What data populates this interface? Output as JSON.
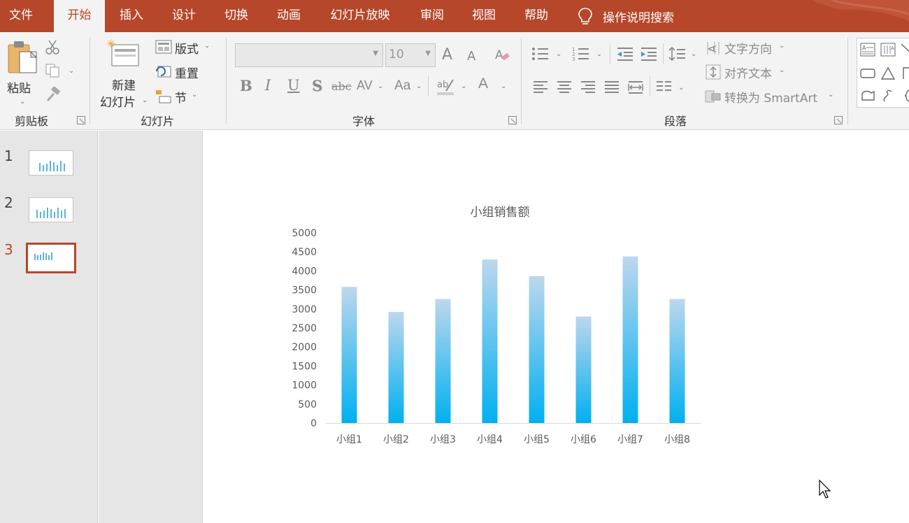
{
  "menu": {
    "tabs": [
      {
        "label": "文件",
        "active": false
      },
      {
        "label": "开始",
        "active": true
      },
      {
        "label": "插入",
        "active": false
      },
      {
        "label": "设计",
        "active": false
      },
      {
        "label": "切换",
        "active": false
      },
      {
        "label": "动画",
        "active": false
      },
      {
        "label": "幻灯片放映",
        "active": false
      },
      {
        "label": "审阅",
        "active": false
      },
      {
        "label": "视图",
        "active": false
      },
      {
        "label": "帮助",
        "active": false
      }
    ],
    "search_label": "操作说明搜索",
    "accent": "#b7472a"
  },
  "ribbon": {
    "clipboard": {
      "paste_label": "粘贴",
      "group_label": "剪贴板"
    },
    "slides": {
      "new_slide_line1": "新建",
      "new_slide_line2": "幻灯片",
      "layout_label": "版式",
      "reset_label": "重置",
      "section_label": "节",
      "group_label": "幻灯片"
    },
    "font": {
      "font_name": "",
      "font_size": "10",
      "group_label": "字体",
      "grow_glyph": "A",
      "shrink_glyph": "A",
      "bold": "B",
      "italic": "I",
      "underline": "U",
      "shadow": "S",
      "strike": "abc",
      "spacing": "AV",
      "case": "Aa",
      "color_glyph": "A"
    },
    "paragraph": {
      "text_direction": "文字方向",
      "align_text": "对齐文本",
      "smartart": "转换为 SmartArt",
      "group_label": "段落"
    }
  },
  "slides": [
    {
      "number": "1",
      "active": false
    },
    {
      "number": "2",
      "active": false
    },
    {
      "number": "3",
      "active": true
    }
  ],
  "chart_data": {
    "type": "bar",
    "title": "小组销售额",
    "categories": [
      "小组1",
      "小组2",
      "小组3",
      "小组4",
      "小组5",
      "小组6",
      "小组7",
      "小组8"
    ],
    "values": [
      3580,
      2920,
      3260,
      4300,
      3860,
      2800,
      4380,
      3260
    ],
    "ylim": [
      0,
      5000
    ],
    "yticks": [
      "0",
      "500",
      "1000",
      "1500",
      "2000",
      "2500",
      "3000",
      "3500",
      "4000",
      "4500",
      "5000"
    ],
    "xlabel": "",
    "ylabel": "",
    "grid": false,
    "colors": {
      "top": "#bdd7ee",
      "bottom": "#00b0f0"
    }
  }
}
